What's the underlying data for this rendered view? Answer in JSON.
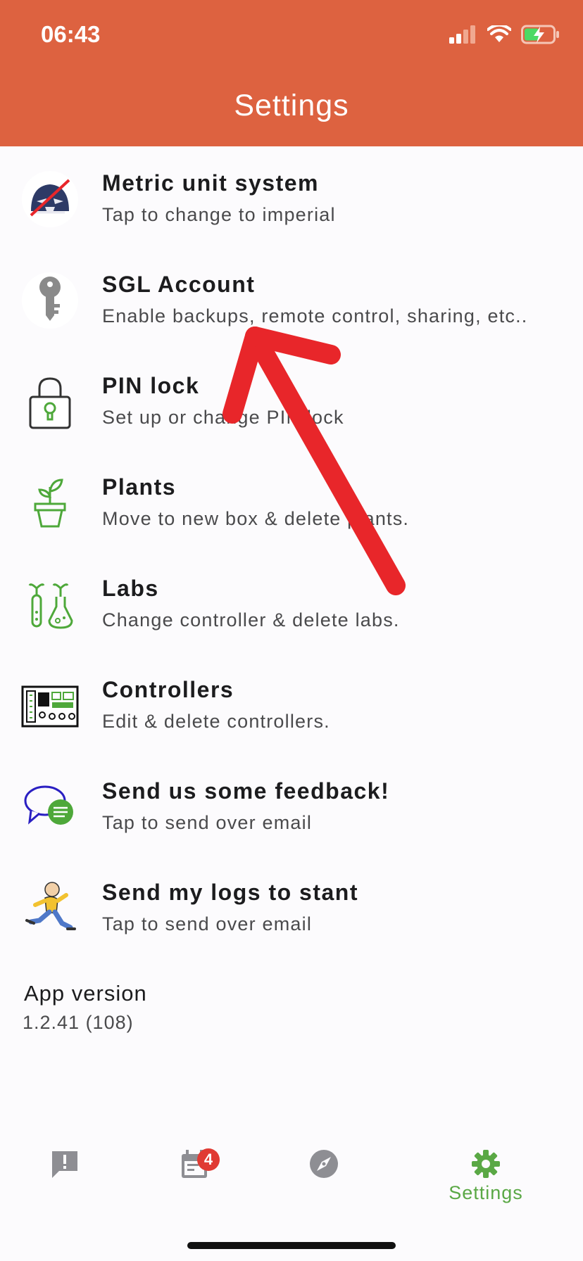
{
  "status_bar": {
    "time": "06:43"
  },
  "header": {
    "title": "Settings"
  },
  "settings": [
    {
      "title": "Metric unit system",
      "subtitle": "Tap to change to imperial",
      "icon": "vader-helmet-icon"
    },
    {
      "title": "SGL Account",
      "subtitle": "Enable backups, remote control, sharing, etc..",
      "icon": "key-icon"
    },
    {
      "title": "PIN lock",
      "subtitle": "Set up or change PIN lock",
      "icon": "padlock-icon"
    },
    {
      "title": "Plants",
      "subtitle": "Move to new box & delete plants.",
      "icon": "potted-plant-icon"
    },
    {
      "title": "Labs",
      "subtitle": "Change controller & delete labs.",
      "icon": "test-tubes-icon"
    },
    {
      "title": "Controllers",
      "subtitle": "Edit & delete controllers.",
      "icon": "circuit-board-icon"
    },
    {
      "title": "Send us some feedback!",
      "subtitle": "Tap to send over email",
      "icon": "chat-bubbles-icon"
    },
    {
      "title": "Send my logs to stant",
      "subtitle": "Tap to send over email",
      "icon": "running-man-icon"
    }
  ],
  "app_version": {
    "label": "App version",
    "value": "1.2.41 (108)"
  },
  "tabbar": {
    "tabs": [
      {
        "name": "alerts",
        "icon": "exclamation-bubble-icon",
        "label": ""
      },
      {
        "name": "calendar",
        "icon": "calendar-icon",
        "label": "",
        "badge": "4"
      },
      {
        "name": "explore",
        "icon": "compass-icon",
        "label": ""
      },
      {
        "name": "settings",
        "icon": "gear-icon",
        "label": "Settings",
        "active": true
      }
    ]
  },
  "colors": {
    "header": "#dd6240",
    "accent": "#5aa845",
    "arrow": "#e8262a",
    "badge": "#e03a33"
  }
}
